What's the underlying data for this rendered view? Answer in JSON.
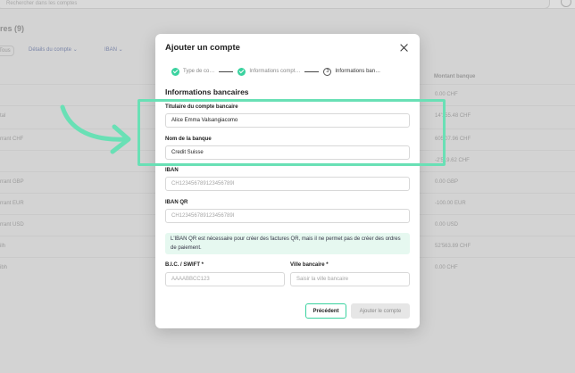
{
  "background": {
    "search_placeholder": "Rechercher dans les comptes",
    "title": "res (9)",
    "filters": [
      "Tous",
      "Détails du compte",
      "IBAN"
    ],
    "column_header": "Montant banque",
    "rows": [
      {
        "label": "",
        "amount": "0.00 CHF"
      },
      {
        "label": "tal",
        "amount": "14'155.48 CHF"
      },
      {
        "label": "rrant CHF",
        "amount": "605'07.96 CHF"
      },
      {
        "label": "",
        "amount": "-2'519.62 CHF"
      },
      {
        "label": "rrant GBP",
        "amount": "0.00 GBP"
      },
      {
        "label": "rrant EUR",
        "amount": "-100.00 EUR"
      },
      {
        "label": "rrant USD",
        "amount": "0.00 USD"
      },
      {
        "label": "ilh",
        "amount": "52'563.89 CHF"
      },
      {
        "label": "ibh",
        "amount": "0.00 CHF"
      }
    ]
  },
  "modal": {
    "title": "Ajouter un compte",
    "steps": [
      {
        "label": "Type de co…",
        "state": "done"
      },
      {
        "label": "Informations compt…",
        "state": "done"
      },
      {
        "number": "3",
        "label": "Informations ban…",
        "state": "active"
      }
    ],
    "section_title": "Informations bancaires",
    "fields": {
      "holder": {
        "label": "Titulaire du compte bancaire",
        "value": "Alice Emma Valsangiacomo"
      },
      "bank_name": {
        "label": "Nom de la banque",
        "value": "Credit Suisse"
      },
      "iban": {
        "label": "IBAN",
        "placeholder": "CH123456789123456789I"
      },
      "iban_qr": {
        "label": "IBAN QR",
        "placeholder": "CH123456789123456789I"
      },
      "bic": {
        "label": "B.I.C. / SWIFT *",
        "placeholder": "AAAABBCC123"
      },
      "city": {
        "label": "Ville bancaire *",
        "placeholder": "Saisir la ville bancaire"
      }
    },
    "info_text": "L'IBAN QR est nécessaire pour créer des factures QR, mais il ne permet pas de créer des ordres de paiement.",
    "buttons": {
      "previous": "Précédent",
      "submit": "Ajouter le compte"
    }
  },
  "colors": {
    "accent": "#3ad29f",
    "highlight": "#69e0b5",
    "info_bg": "#e6f8f0"
  }
}
